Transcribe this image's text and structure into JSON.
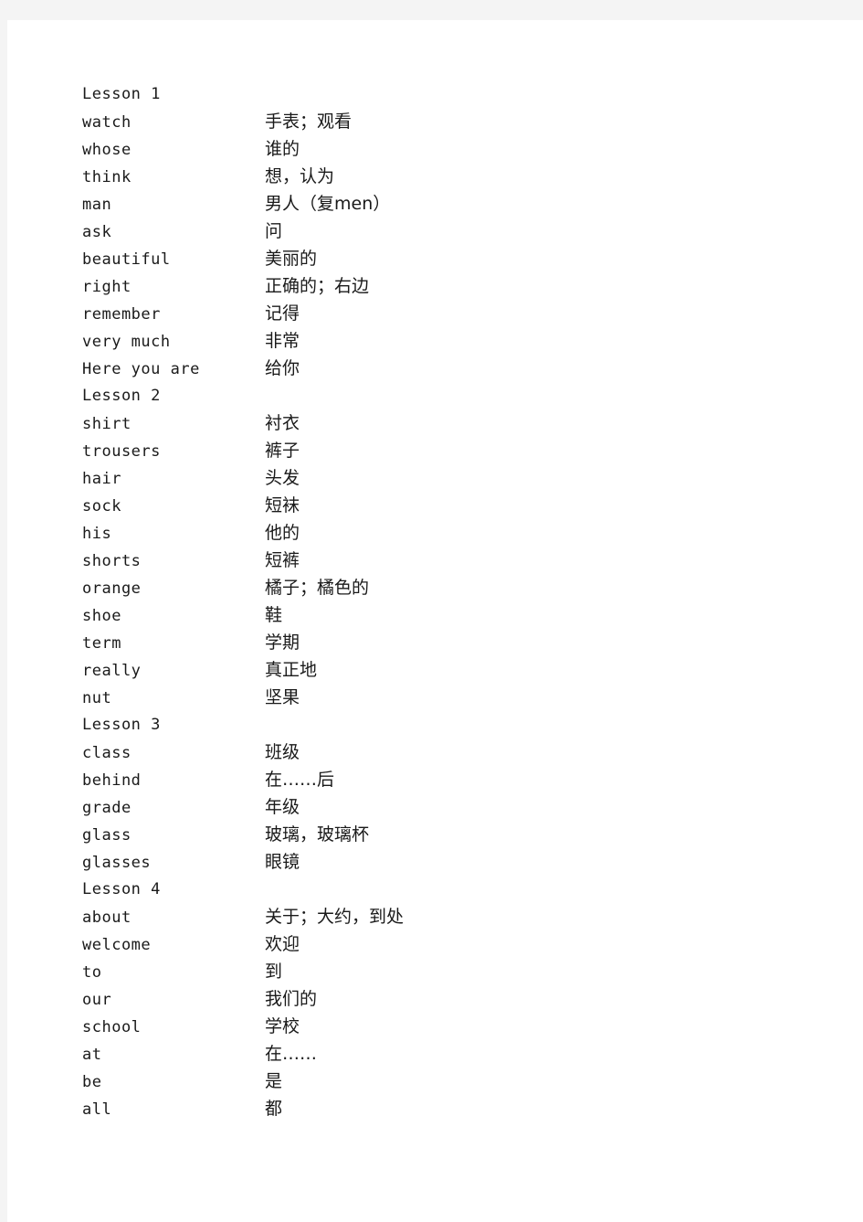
{
  "document": {
    "entries": [
      {
        "type": "lesson",
        "term": "Lesson 1",
        "definition": ""
      },
      {
        "type": "word",
        "term": "watch",
        "definition": "手表；观看"
      },
      {
        "type": "word",
        "term": "whose",
        "definition": "谁的"
      },
      {
        "type": "word",
        "term": "think",
        "definition": "想，认为"
      },
      {
        "type": "word",
        "term": "man",
        "definition": "男人（复men）"
      },
      {
        "type": "word",
        "term": "ask",
        "definition": "问"
      },
      {
        "type": "word",
        "term": "beautiful",
        "definition": "美丽的"
      },
      {
        "type": "word",
        "term": "right",
        "definition": "正确的；右边"
      },
      {
        "type": "word",
        "term": "remember",
        "definition": "记得"
      },
      {
        "type": "word",
        "term": "very much",
        "definition": "非常"
      },
      {
        "type": "word",
        "term": "Here you are",
        "definition": "给你"
      },
      {
        "type": "lesson",
        "term": "Lesson 2",
        "definition": ""
      },
      {
        "type": "word",
        "term": "shirt",
        "definition": "衬衣"
      },
      {
        "type": "word",
        "term": "trousers",
        "definition": "裤子"
      },
      {
        "type": "word",
        "term": "hair",
        "definition": "头发"
      },
      {
        "type": "word",
        "term": "sock",
        "definition": "短袜"
      },
      {
        "type": "word",
        "term": "his",
        "definition": "他的"
      },
      {
        "type": "word",
        "term": "shorts",
        "definition": "短裤"
      },
      {
        "type": "word",
        "term": "orange",
        "definition": "橘子；橘色的"
      },
      {
        "type": "word",
        "term": "shoe",
        "definition": "鞋"
      },
      {
        "type": "word",
        "term": "term",
        "definition": "学期"
      },
      {
        "type": "word",
        "term": "really",
        "definition": "真正地"
      },
      {
        "type": "word",
        "term": "nut",
        "definition": "坚果"
      },
      {
        "type": "lesson",
        "term": "Lesson 3",
        "definition": ""
      },
      {
        "type": "word",
        "term": "class",
        "definition": "班级"
      },
      {
        "type": "word",
        "term": "behind",
        "definition": "在……后"
      },
      {
        "type": "word",
        "term": "grade",
        "definition": "年级"
      },
      {
        "type": "word",
        "term": "glass",
        "definition": "玻璃，玻璃杯"
      },
      {
        "type": "word",
        "term": "glasses",
        "definition": "眼镜"
      },
      {
        "type": "lesson",
        "term": "Lesson 4",
        "definition": ""
      },
      {
        "type": "word",
        "term": "about",
        "definition": "关于；大约，到处"
      },
      {
        "type": "word",
        "term": "welcome",
        "definition": "欢迎"
      },
      {
        "type": "word",
        "term": "to",
        "definition": "到"
      },
      {
        "type": "word",
        "term": "our",
        "definition": "我们的"
      },
      {
        "type": "word",
        "term": "school",
        "definition": "学校"
      },
      {
        "type": "word",
        "term": "at",
        "definition": "在……"
      },
      {
        "type": "word",
        "term": "be",
        "definition": "是"
      },
      {
        "type": "word",
        "term": "all",
        "definition": "都"
      }
    ]
  }
}
